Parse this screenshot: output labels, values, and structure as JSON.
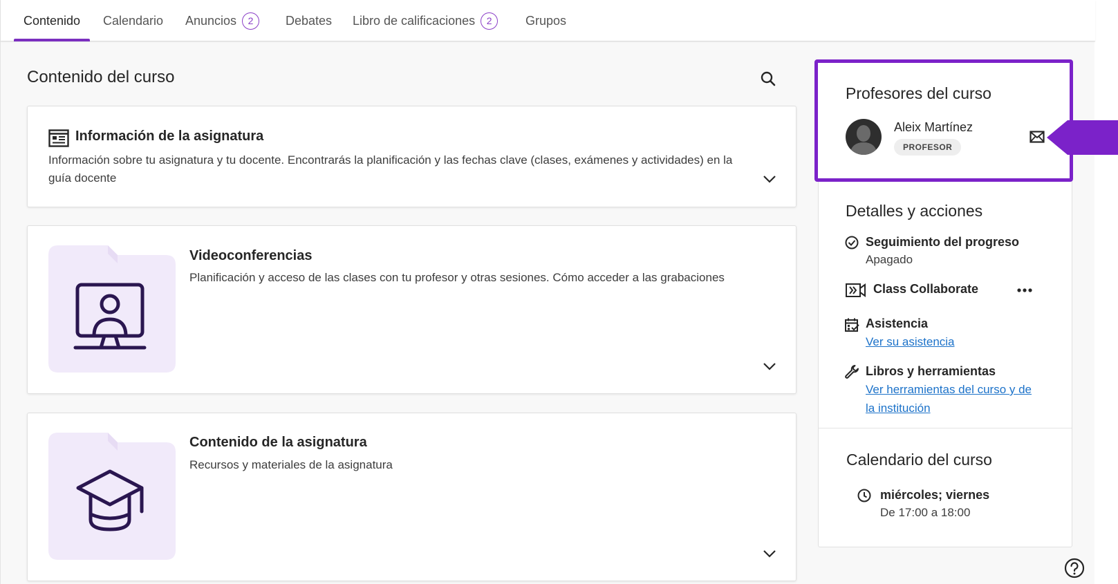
{
  "tabs": [
    {
      "label": "Contenido",
      "active": true
    },
    {
      "label": "Calendario"
    },
    {
      "label": "Anuncios",
      "count": "2"
    },
    {
      "label": "Debates"
    },
    {
      "label": "Libro de calificaciones",
      "count": "2"
    },
    {
      "label": "Grupos"
    }
  ],
  "main": {
    "title": "Contenido del curso",
    "cards": [
      {
        "title": "Información de la asignatura",
        "description": "Información sobre tu asignatura y tu docente. Encontrarás la planificación y las fechas clave (clases, exámenes y actividades) en la guía docente",
        "icon": "document-list-icon"
      },
      {
        "title": "Videoconferencias",
        "description": "Planificación y acceso de las clases con tu profesor y otras sesiones. Cómo acceder a las grabaciones",
        "icon": "monitor-user-icon"
      },
      {
        "title": "Contenido de la asignatura",
        "description": "Recursos y materiales de la asignatura",
        "icon": "graduation-cap-icon"
      }
    ]
  },
  "sidebar": {
    "teachers_heading": "Profesores del curso",
    "teacher": {
      "name": "Aleix Martínez",
      "role": "PROFESOR"
    },
    "details_heading": "Detalles y acciones",
    "progress": {
      "label": "Seguimiento del progreso",
      "value": "Apagado"
    },
    "collaborate": {
      "label": "Class Collaborate"
    },
    "attendance": {
      "label": "Asistencia",
      "link": "Ver su asistencia"
    },
    "tools": {
      "label": "Libros y herramientas",
      "link_line1": "Ver herramientas del curso y de",
      "link_line2": "la institución"
    },
    "calendar_heading": "Calendario del curso",
    "schedule": {
      "days": "miércoles; viernes",
      "time": "De 17:00 a 18:00"
    }
  },
  "colors": {
    "accent": "#7b2fbf",
    "highlight_border": "#7b22c9",
    "link": "#1c72c9",
    "folder_bg": "#f1eafa",
    "icon_stroke": "#2a1650"
  }
}
